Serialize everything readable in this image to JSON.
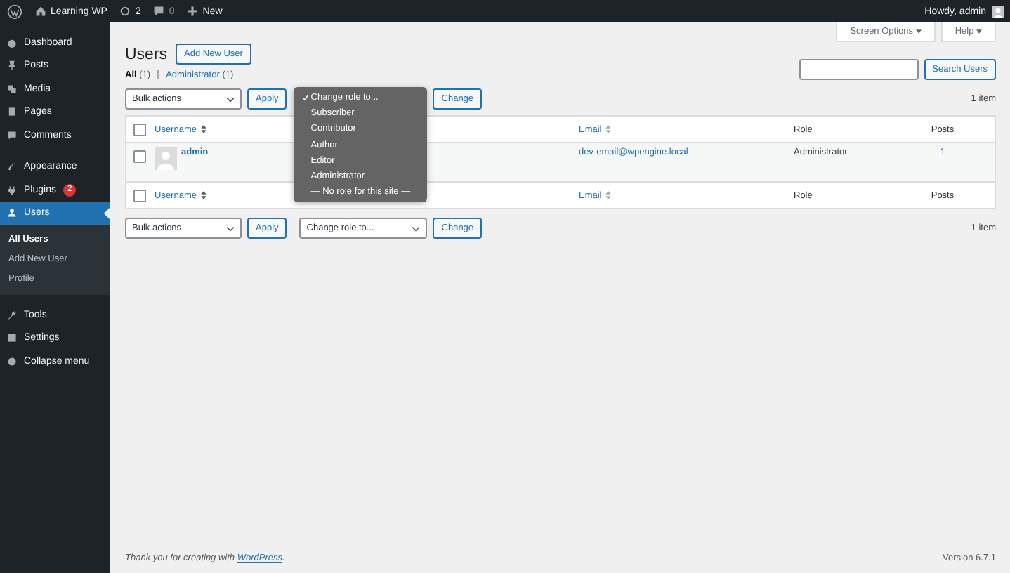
{
  "admin_bar": {
    "site_name": "Learning WP",
    "updates_count": "2",
    "comments_count": "0",
    "new_label": "New",
    "greeting": "Howdy, admin"
  },
  "sidebar": {
    "items": [
      {
        "label": "Dashboard",
        "selected": false
      },
      {
        "label": "Posts",
        "selected": false
      },
      {
        "label": "Media",
        "selected": false
      },
      {
        "label": "Pages",
        "selected": false
      },
      {
        "label": "Comments",
        "selected": false
      },
      {
        "label": "Appearance",
        "selected": false
      },
      {
        "label": "Plugins",
        "selected": false,
        "badge": "2"
      },
      {
        "label": "Users",
        "selected": true,
        "children": [
          {
            "label": "All Users",
            "selected": true
          },
          {
            "label": "Add New User",
            "selected": false
          },
          {
            "label": "Profile",
            "selected": false
          }
        ]
      },
      {
        "label": "Tools",
        "selected": false
      },
      {
        "label": "Settings",
        "selected": false
      },
      {
        "label": "Collapse menu",
        "selected": false
      }
    ]
  },
  "screen_tabs": [
    "Screen Options",
    "Help"
  ],
  "page": {
    "title": "Users",
    "add_button": "Add New User",
    "filters": [
      {
        "label": "All",
        "count": "(1)",
        "selected": true
      },
      {
        "label": "Administrator",
        "count": "(1)",
        "selected": false
      }
    ],
    "search_button": "Search Users"
  },
  "top_nav": {
    "bulk_select": "Bulk actions",
    "apply": "Apply",
    "change": "Change",
    "count": "1 item",
    "role_menu": [
      {
        "label": "Change role to...",
        "selected": true
      },
      {
        "label": "Subscriber",
        "selected": false
      },
      {
        "label": "Contributor",
        "selected": false
      },
      {
        "label": "Author",
        "selected": false
      },
      {
        "label": "Editor",
        "selected": false
      },
      {
        "label": "Administrator",
        "selected": false
      },
      {
        "label": "— No role for this site —",
        "selected": false
      }
    ]
  },
  "table": {
    "columns": [
      {
        "label": "Username",
        "sortable": true
      },
      {
        "label": "Email",
        "sortable": true
      },
      {
        "label": "Role",
        "sortable": false
      },
      {
        "label": "Posts",
        "sortable": false
      }
    ],
    "footer_columns": [
      {
        "label": "Username",
        "sortable": true
      },
      {
        "label": "Email",
        "sortable": true
      },
      {
        "label": "Role",
        "sortable": false
      },
      {
        "label": "Posts",
        "sortable": false
      }
    ],
    "rows": [
      {
        "checked": false,
        "username": "admin",
        "email": "dev-email@wpengine.local",
        "role": "Administrator",
        "posts": "1"
      }
    ],
    "header_checked": false,
    "footer_checked": false
  },
  "bottom_nav": {
    "bulk_select": "Bulk actions",
    "apply": "Apply",
    "role_select": "Change role to...",
    "change": "Change",
    "count": "1 item"
  },
  "footer": {
    "thanks_before": "Thank you for creating with ",
    "thanks_link": "WordPress",
    "thanks_after": ".",
    "version": "Version 6.7.1"
  }
}
